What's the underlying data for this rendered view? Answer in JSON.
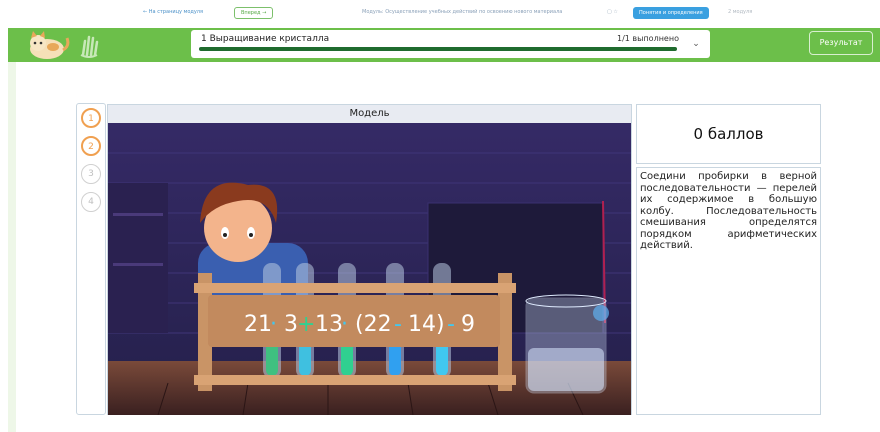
{
  "topnav": {
    "back_label": "← На страницу модуля",
    "forward_label": "Вперед →",
    "module_label": "Модуль: Осуществление учебных действий по освоению нового материала",
    "icons_label": "▢ ☆",
    "concepts_button": "Понятия и определения",
    "extra_label": "2 модуля"
  },
  "task": {
    "title": "1 Выращивание кристалла",
    "done": "1/1 выполнено",
    "progress": 1.0
  },
  "result_button": "Результат",
  "steps": [
    "1",
    "2",
    "3",
    "4"
  ],
  "model": {
    "title": "Модель",
    "expression": [
      "21",
      "·",
      "3",
      "+",
      "13",
      "·",
      "(22",
      "-",
      "14)",
      "-",
      "9"
    ]
  },
  "score": "0 баллов",
  "description": "Соедини пробирки в верной последовательности — перелей их содержимое в большую колбу. Последовательность смешивания определятся порядком арифметических действий.",
  "colors": {
    "green_bar": "#6cbf4a",
    "progress": "#1f6b2e",
    "step_active": "#f0a050",
    "scene_bg": "#2b2254"
  }
}
